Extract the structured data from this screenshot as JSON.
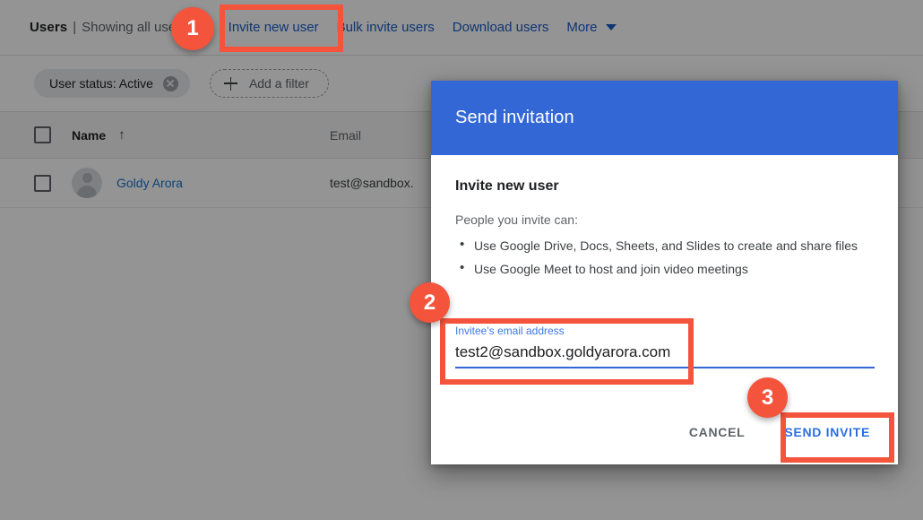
{
  "toolbar": {
    "title": "Users",
    "separator": "|",
    "subtitle": "Showing all users",
    "links": [
      {
        "label": "Invite new user"
      },
      {
        "label": "Bulk invite users"
      },
      {
        "label": "Download users"
      },
      {
        "label": "More"
      }
    ],
    "more_caret_icon": "chevron-down-icon"
  },
  "filters": {
    "chip_label": "User status: Active",
    "chip_remove_icon": "close-circle-icon",
    "add_filter_label": "Add a filter",
    "add_filter_icon": "plus-icon"
  },
  "table": {
    "columns": {
      "name": "Name",
      "email": "Email"
    },
    "sort_icon": "arrow-up-icon",
    "rows": [
      {
        "name": "Goldy Arora",
        "email": "test@sandbox.",
        "avatar_icon": "person-avatar-icon"
      }
    ]
  },
  "dialog": {
    "title": "Send invitation",
    "heading": "Invite new user",
    "lead": "People you invite can:",
    "bullets": [
      "Use Google Drive, Docs, Sheets, and Slides to create and share files",
      "Use Google Meet to host and join video meetings"
    ],
    "field": {
      "label": "Invitee's email address",
      "value": "test2@sandbox.goldyarora.com",
      "placeholder": ""
    },
    "cancel_label": "CANCEL",
    "send_label": "SEND INVITE",
    "header_color": "#3367d6",
    "accent_color": "#2a6fe0"
  },
  "annotations": {
    "color": "#f4543c",
    "steps": [
      {
        "number": "1"
      },
      {
        "number": "2"
      },
      {
        "number": "3"
      }
    ]
  }
}
